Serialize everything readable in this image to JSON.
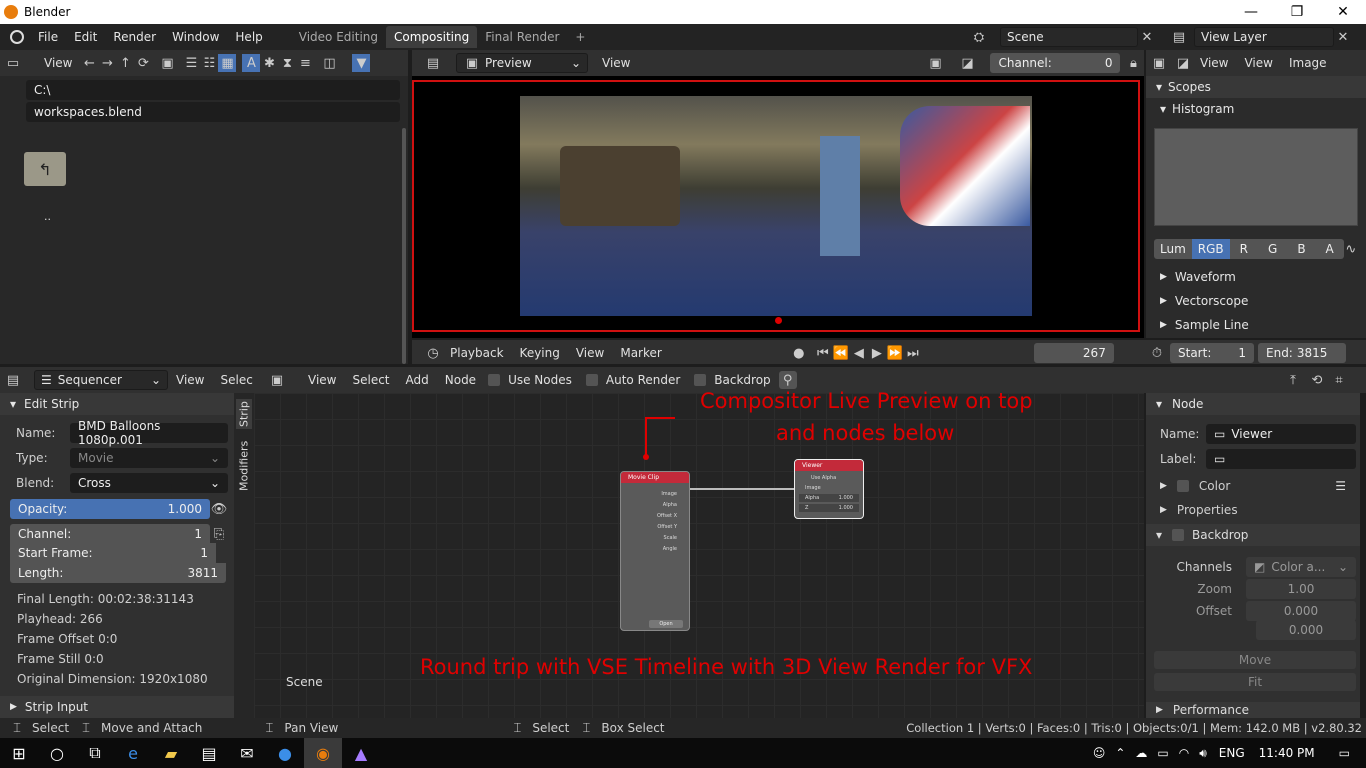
{
  "window": {
    "title": "Blender",
    "minimize": "—",
    "maximize": "❐",
    "close": "✕"
  },
  "menubar": {
    "menus": [
      "File",
      "Edit",
      "Render",
      "Window",
      "Help"
    ],
    "workspaces": [
      "Video Editing",
      "Compositing",
      "Final Render"
    ],
    "active_workspace": "Compositing",
    "add_tab": "+",
    "scene_name": "Scene",
    "view_layer": "View Layer"
  },
  "filebrowser": {
    "view_menu": "View",
    "path": "C:\\",
    "filename": "workspaces.blend",
    "parent_label": ".."
  },
  "preview": {
    "mode": "Preview",
    "view_menu": "View",
    "channel_label": "Channel:",
    "channel_value": "0"
  },
  "scopes": {
    "view_menus": [
      "View",
      "View",
      "Image"
    ],
    "title": "Scopes",
    "histogram": "Histogram",
    "channels": [
      "Lum",
      "RGB",
      "R",
      "G",
      "B",
      "A"
    ],
    "active_channel": "RGB",
    "sections": [
      "Waveform",
      "Vectorscope",
      "Sample Line"
    ]
  },
  "timeline": {
    "playback": "Playback",
    "keying": "Keying",
    "view": "View",
    "marker": "Marker",
    "current_frame": "267",
    "start_label": "Start:",
    "start": "1",
    "end_label": "End:",
    "end": "3815"
  },
  "sequencer": {
    "editor": "Sequencer",
    "view": "View",
    "select": "Selec",
    "edit_strip": "Edit Strip",
    "tabs": [
      "Strip",
      "Modifiers"
    ],
    "name_label": "Name:",
    "name_value": "BMD Balloons 1080p.001",
    "type_label": "Type:",
    "type_value": "Movie",
    "blend_label": "Blend:",
    "blend_value": "Cross",
    "opacity_label": "Opacity:",
    "opacity_value": "1.000",
    "channel_label": "Channel:",
    "channel_value": "1",
    "start_label": "Start Frame:",
    "start_value": "1",
    "length_label": "Length:",
    "length_value": "3811",
    "info": [
      "Final Length: 00:02:38:31143",
      "Playhead: 266",
      "Frame Offset 0:0",
      "Frame Still 0:0",
      "Original Dimension: 1920x1080"
    ],
    "strip_input": "Strip Input"
  },
  "node_editor": {
    "menus": [
      "View",
      "Select",
      "Add",
      "Node"
    ],
    "toggles": [
      "Use Nodes",
      "Auto Render",
      "Backdrop"
    ],
    "scene_label": "Scene",
    "annotation_top_1": "Compositor Live Preview on top",
    "annotation_top_2": "and nodes below",
    "annotation_bottom": "Round trip with VSE Timeline with 3D  View Render for VFX",
    "movieclip": {
      "title": "Movie Clip",
      "outputs": [
        "Image",
        "Alpha",
        "Offset X",
        "Offset Y",
        "Scale",
        "Angle"
      ],
      "open": "Open"
    },
    "viewer": {
      "title": "Viewer",
      "use_alpha": "Use Alpha",
      "image": "Image",
      "alpha": "Alpha",
      "alpha_val": "1.000",
      "z": "Z",
      "z_val": "1.000"
    }
  },
  "node_panel": {
    "title": "Node",
    "name_label": "Name:",
    "name_value": "Viewer",
    "label_label": "Label:",
    "color": "Color",
    "properties": "Properties",
    "backdrop": "Backdrop",
    "channels_label": "Channels",
    "channels_value": "Color a...",
    "zoom_label": "Zoom",
    "zoom_value": "1.00",
    "offset_label": "Offset",
    "offset_x": "0.000",
    "offset_y": "0.000",
    "move": "Move",
    "fit": "Fit",
    "performance": "Performance"
  },
  "statusbar": {
    "items": [
      "Select",
      "Move and Attach",
      "Pan View",
      "Select",
      "Box Select"
    ],
    "stats": "Collection 1 | Verts:0 | Faces:0 | Tris:0 | Objects:0/1 | Mem: 142.0 MB | v2.80.32"
  },
  "taskbar": {
    "lang": "ENG",
    "time": "11:40 PM"
  },
  "colors": {
    "accent": "#4772b3",
    "annotation": "#e00000",
    "node_header": "#c32a3a"
  }
}
